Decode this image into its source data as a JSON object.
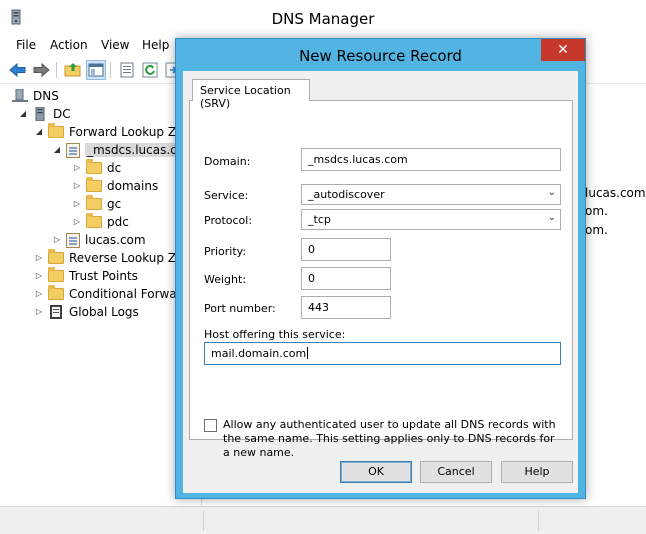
{
  "window": {
    "title": "DNS Manager"
  },
  "menu": [
    "File",
    "Action",
    "View",
    "Help"
  ],
  "toolbar": {
    "icons": [
      "back-arrow-icon",
      "forward-arrow-icon",
      "up-folder-icon",
      "show-hide-tree-icon",
      "properties-icon",
      "refresh-icon",
      "export-icon"
    ]
  },
  "tree": {
    "root": "DNS",
    "server": "DC",
    "forward_zones": "Forward Lookup Zo",
    "msdcs_zone": "_msdcs.lucas.co",
    "msdcs_children": [
      "dc",
      "domains",
      "gc",
      "pdc"
    ],
    "lucas_zone": "lucas.com",
    "reverse_zones": "Reverse Lookup Zo",
    "trust_points": "Trust Points",
    "conditional": "Conditional Forward",
    "global_logs": "Global Logs"
  },
  "right_pane": {
    "lines": [
      "lucas.com.,",
      "om.",
      "om."
    ]
  },
  "dialog": {
    "title": "New Resource Record",
    "close_glyph": "✕",
    "tab_label": "Service Location (SRV)",
    "domain_label": "Domain:",
    "domain_value": "_msdcs.lucas.com",
    "service_label": "Service:",
    "service_value": "_autodiscover",
    "protocol_label": "Protocol:",
    "protocol_value": "_tcp",
    "priority_label": "Priority:",
    "priority_value": "0",
    "weight_label": "Weight:",
    "weight_value": "0",
    "port_label": "Port number:",
    "port_value": "443",
    "host_label": "Host offering this service:",
    "host_value": "mail.domain.com",
    "checkbox_label": "Allow any authenticated user to update all DNS records with the same name. This setting applies only to DNS records for a new name.",
    "checkbox_checked": false,
    "ok_label": "OK",
    "cancel_label": "Cancel",
    "help_label": "Help"
  },
  "colors": {
    "dialog_frame": "#52b4e3",
    "close_button": "#c7372a",
    "selection": "#d9d9d9"
  }
}
